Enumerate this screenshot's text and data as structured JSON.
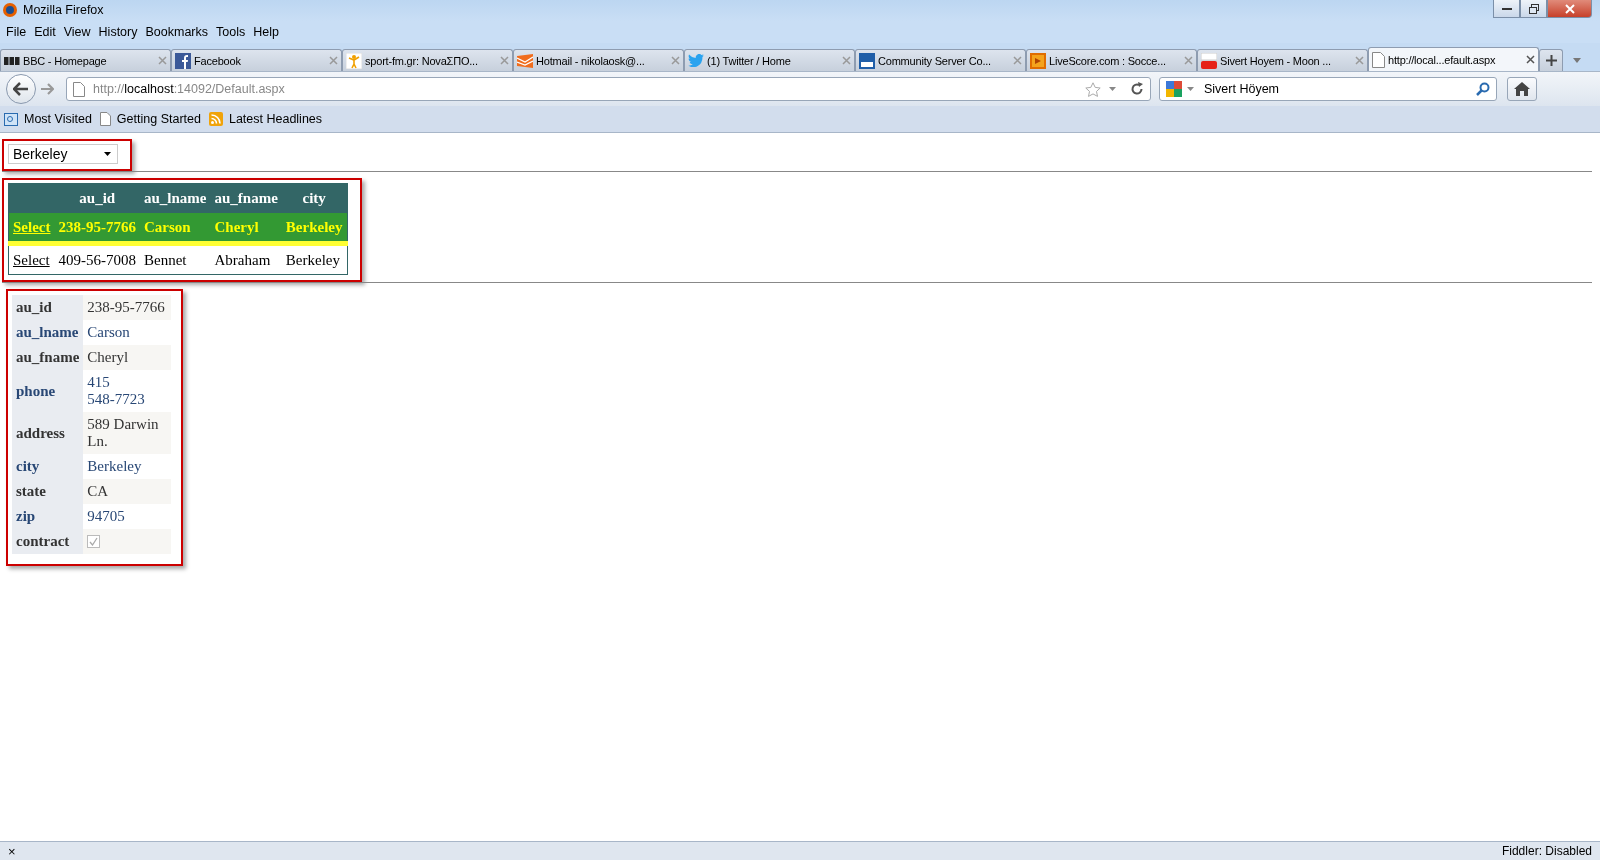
{
  "window": {
    "title": "Mozilla Firefox"
  },
  "menu": [
    "File",
    "Edit",
    "View",
    "History",
    "Bookmarks",
    "Tools",
    "Help"
  ],
  "tabs": [
    {
      "label": "BBC - Homepage",
      "kind": "wordmark",
      "selected": false
    },
    {
      "label": "Facebook",
      "kind": "letter-square",
      "selected": false
    },
    {
      "label": "sport-fm.gr: NovaΣΠΟ...",
      "kind": "figure",
      "selected": false
    },
    {
      "label": "Hotmail - nikolaosk@...",
      "kind": "envelope",
      "selected": false
    },
    {
      "label": "(1) Twitter / Home",
      "kind": "bird",
      "selected": false
    },
    {
      "label": "Community Server Co...",
      "kind": "blue-square",
      "selected": false
    },
    {
      "label": "LiveScore.com : Socce...",
      "kind": "orange-square",
      "selected": false
    },
    {
      "label": "Sivert Hoyem - Moon ...",
      "kind": "video",
      "selected": false
    },
    {
      "label": "http://local...efault.aspx",
      "kind": "page",
      "selected": true
    }
  ],
  "address_bar": {
    "scheme": "http://",
    "host": "localhost",
    "path": ":14092/Default.aspx"
  },
  "search": {
    "value": "Sivert Höyem"
  },
  "bookmarks": [
    {
      "label": "Most Visited",
      "kind": "folder"
    },
    {
      "label": "Getting Started",
      "kind": "page"
    },
    {
      "label": "Latest Headlines",
      "kind": "feed"
    }
  ],
  "city_dropdown": {
    "value": "Berkeley"
  },
  "authors_grid": {
    "columns": [
      "au_id",
      "au_lname",
      "au_fname",
      "city"
    ],
    "rows": [
      {
        "action": "Select",
        "selected": true,
        "cells": [
          "238-95-7766",
          "Carson",
          "Cheryl",
          "Berkeley"
        ]
      },
      {
        "action": "Select",
        "selected": false,
        "cells": [
          "409-56-7008",
          "Bennet",
          "Abraham",
          "Berkeley"
        ]
      }
    ]
  },
  "author_details": [
    {
      "label": "au_id",
      "kind": "text",
      "lines": [
        "238-95-7766"
      ]
    },
    {
      "label": "au_lname",
      "kind": "text",
      "lines": [
        "Carson"
      ]
    },
    {
      "label": "au_fname",
      "kind": "text",
      "lines": [
        "Cheryl"
      ]
    },
    {
      "label": "phone",
      "kind": "text",
      "lines": [
        "415",
        "548-7723"
      ]
    },
    {
      "label": "address",
      "kind": "text",
      "lines": [
        "589 Darwin",
        "Ln."
      ]
    },
    {
      "label": "city",
      "kind": "text",
      "lines": [
        "Berkeley"
      ]
    },
    {
      "label": "state",
      "kind": "text",
      "lines": [
        "CA"
      ]
    },
    {
      "label": "zip",
      "kind": "text",
      "lines": [
        "94705"
      ]
    },
    {
      "label": "contract",
      "kind": "checkbox",
      "checked": true,
      "disabled": true
    }
  ],
  "status_bar": {
    "close": "×",
    "text": "Fiddler: Disabled"
  }
}
